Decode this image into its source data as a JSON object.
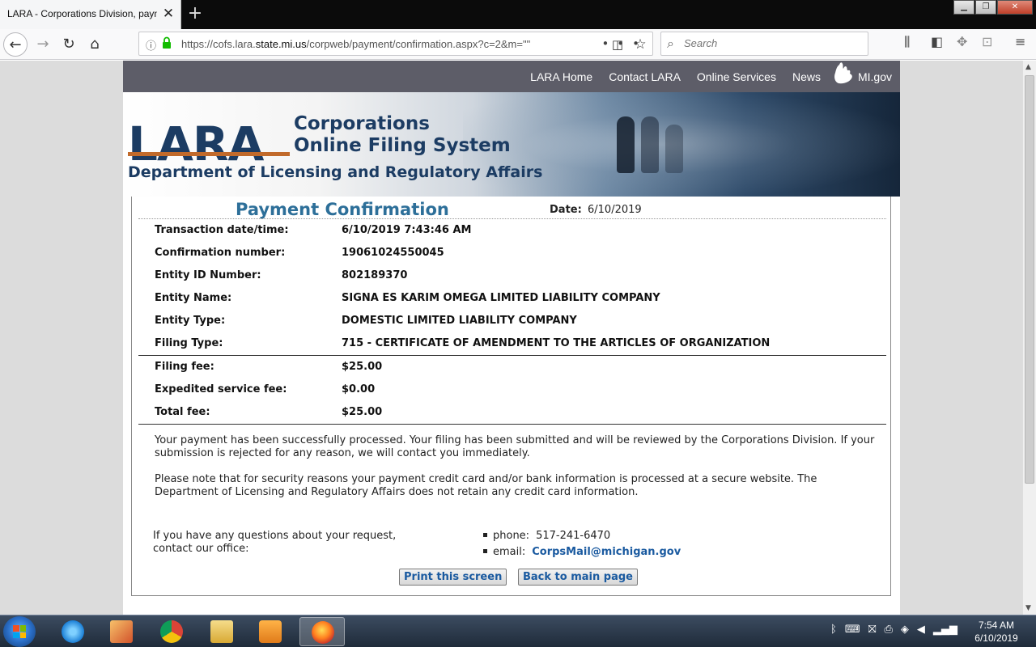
{
  "browser": {
    "tab_title": "LARA - Corporations Division, paym",
    "new_tab": "+",
    "url_prefix": "https://cofs.lara.",
    "url_domain": "state.mi.us",
    "url_suffix": "/corpweb/payment/confirmation.aspx?c=2&m=\"\"",
    "search_placeholder": "Search"
  },
  "site_nav": {
    "links": [
      "LARA Home",
      "Contact LARA",
      "Online Services",
      "News",
      "MI.gov"
    ]
  },
  "banner": {
    "logo": "LARA",
    "title_line1": "Corporations",
    "title_line2": "Online Filing System",
    "department": "Department of Licensing and Regulatory Affairs"
  },
  "confirmation": {
    "title": "Payment Confirmation",
    "date_label": "Date:",
    "date_value": "6/10/2019",
    "details": [
      {
        "label": "Transaction date/time:",
        "value": "6/10/2019 7:43:46 AM"
      },
      {
        "label": "Confirmation number:",
        "value": "19061024550045"
      },
      {
        "label": "Entity ID Number:",
        "value": "802189370"
      },
      {
        "label": "Entity Name:",
        "value": "SIGNA ES KARIM OMEGA LIMITED LIABILITY COMPANY"
      },
      {
        "label": "Entity Type:",
        "value": "DOMESTIC LIMITED LIABILITY COMPANY"
      },
      {
        "label": "Filing Type:",
        "value": "715 - CERTIFICATE OF AMENDMENT TO THE ARTICLES OF ORGANIZATION"
      }
    ],
    "fees": [
      {
        "label": "Filing fee:",
        "value": "$25.00"
      },
      {
        "label": "Expedited service fee:",
        "value": "$0.00"
      },
      {
        "label": "Total fee:",
        "value": "$25.00"
      }
    ],
    "message1": "Your payment has been successfully processed. Your filing has been submitted and will be reviewed by the Corporations Division. If your submission is rejected for any reason, we will contact you immediately.",
    "message2": "Please note that for security reasons your payment credit card and/or bank information is processed at a secure website. The Department of Licensing and Regulatory Affairs does not retain any credit card information.",
    "contact_question": "If you have any questions about your request, contact our office:",
    "phone_label": "phone:",
    "phone_value": "517-241-6470",
    "email_label": "email:",
    "email_value": "CorpsMail@michigan.gov",
    "print_button": "Print this screen",
    "back_button": "Back to main page"
  },
  "taskbar": {
    "time": "7:54 AM",
    "date": "6/10/2019"
  },
  "colors": {
    "title_blue": "#2d6f99",
    "nav_bar": "#5d5d68",
    "link_blue": "#1a5aa0",
    "logo_navy": "#1c3c63",
    "logo_orange": "#c16a2b"
  }
}
